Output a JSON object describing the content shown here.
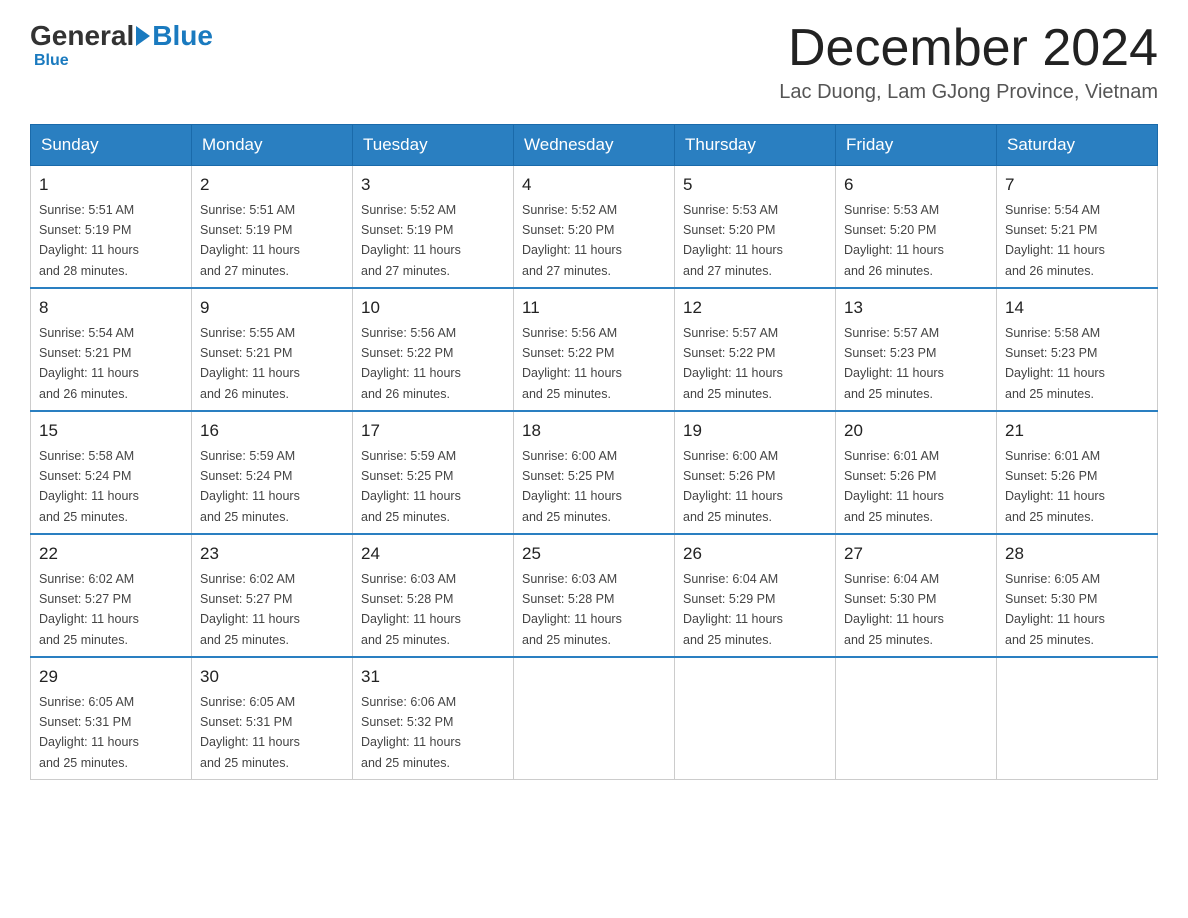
{
  "logo": {
    "general": "General",
    "blue": "Blue"
  },
  "header": {
    "month": "December 2024",
    "location": "Lac Duong, Lam GJong Province, Vietnam"
  },
  "weekdays": [
    "Sunday",
    "Monday",
    "Tuesday",
    "Wednesday",
    "Thursday",
    "Friday",
    "Saturday"
  ],
  "weeks": [
    [
      {
        "day": "1",
        "sunrise": "5:51 AM",
        "sunset": "5:19 PM",
        "daylight": "11 hours and 28 minutes."
      },
      {
        "day": "2",
        "sunrise": "5:51 AM",
        "sunset": "5:19 PM",
        "daylight": "11 hours and 27 minutes."
      },
      {
        "day": "3",
        "sunrise": "5:52 AM",
        "sunset": "5:19 PM",
        "daylight": "11 hours and 27 minutes."
      },
      {
        "day": "4",
        "sunrise": "5:52 AM",
        "sunset": "5:20 PM",
        "daylight": "11 hours and 27 minutes."
      },
      {
        "day": "5",
        "sunrise": "5:53 AM",
        "sunset": "5:20 PM",
        "daylight": "11 hours and 27 minutes."
      },
      {
        "day": "6",
        "sunrise": "5:53 AM",
        "sunset": "5:20 PM",
        "daylight": "11 hours and 26 minutes."
      },
      {
        "day": "7",
        "sunrise": "5:54 AM",
        "sunset": "5:21 PM",
        "daylight": "11 hours and 26 minutes."
      }
    ],
    [
      {
        "day": "8",
        "sunrise": "5:54 AM",
        "sunset": "5:21 PM",
        "daylight": "11 hours and 26 minutes."
      },
      {
        "day": "9",
        "sunrise": "5:55 AM",
        "sunset": "5:21 PM",
        "daylight": "11 hours and 26 minutes."
      },
      {
        "day": "10",
        "sunrise": "5:56 AM",
        "sunset": "5:22 PM",
        "daylight": "11 hours and 26 minutes."
      },
      {
        "day": "11",
        "sunrise": "5:56 AM",
        "sunset": "5:22 PM",
        "daylight": "11 hours and 25 minutes."
      },
      {
        "day": "12",
        "sunrise": "5:57 AM",
        "sunset": "5:22 PM",
        "daylight": "11 hours and 25 minutes."
      },
      {
        "day": "13",
        "sunrise": "5:57 AM",
        "sunset": "5:23 PM",
        "daylight": "11 hours and 25 minutes."
      },
      {
        "day": "14",
        "sunrise": "5:58 AM",
        "sunset": "5:23 PM",
        "daylight": "11 hours and 25 minutes."
      }
    ],
    [
      {
        "day": "15",
        "sunrise": "5:58 AM",
        "sunset": "5:24 PM",
        "daylight": "11 hours and 25 minutes."
      },
      {
        "day": "16",
        "sunrise": "5:59 AM",
        "sunset": "5:24 PM",
        "daylight": "11 hours and 25 minutes."
      },
      {
        "day": "17",
        "sunrise": "5:59 AM",
        "sunset": "5:25 PM",
        "daylight": "11 hours and 25 minutes."
      },
      {
        "day": "18",
        "sunrise": "6:00 AM",
        "sunset": "5:25 PM",
        "daylight": "11 hours and 25 minutes."
      },
      {
        "day": "19",
        "sunrise": "6:00 AM",
        "sunset": "5:26 PM",
        "daylight": "11 hours and 25 minutes."
      },
      {
        "day": "20",
        "sunrise": "6:01 AM",
        "sunset": "5:26 PM",
        "daylight": "11 hours and 25 minutes."
      },
      {
        "day": "21",
        "sunrise": "6:01 AM",
        "sunset": "5:26 PM",
        "daylight": "11 hours and 25 minutes."
      }
    ],
    [
      {
        "day": "22",
        "sunrise": "6:02 AM",
        "sunset": "5:27 PM",
        "daylight": "11 hours and 25 minutes."
      },
      {
        "day": "23",
        "sunrise": "6:02 AM",
        "sunset": "5:27 PM",
        "daylight": "11 hours and 25 minutes."
      },
      {
        "day": "24",
        "sunrise": "6:03 AM",
        "sunset": "5:28 PM",
        "daylight": "11 hours and 25 minutes."
      },
      {
        "day": "25",
        "sunrise": "6:03 AM",
        "sunset": "5:28 PM",
        "daylight": "11 hours and 25 minutes."
      },
      {
        "day": "26",
        "sunrise": "6:04 AM",
        "sunset": "5:29 PM",
        "daylight": "11 hours and 25 minutes."
      },
      {
        "day": "27",
        "sunrise": "6:04 AM",
        "sunset": "5:30 PM",
        "daylight": "11 hours and 25 minutes."
      },
      {
        "day": "28",
        "sunrise": "6:05 AM",
        "sunset": "5:30 PM",
        "daylight": "11 hours and 25 minutes."
      }
    ],
    [
      {
        "day": "29",
        "sunrise": "6:05 AM",
        "sunset": "5:31 PM",
        "daylight": "11 hours and 25 minutes."
      },
      {
        "day": "30",
        "sunrise": "6:05 AM",
        "sunset": "5:31 PM",
        "daylight": "11 hours and 25 minutes."
      },
      {
        "day": "31",
        "sunrise": "6:06 AM",
        "sunset": "5:32 PM",
        "daylight": "11 hours and 25 minutes."
      },
      null,
      null,
      null,
      null
    ]
  ]
}
